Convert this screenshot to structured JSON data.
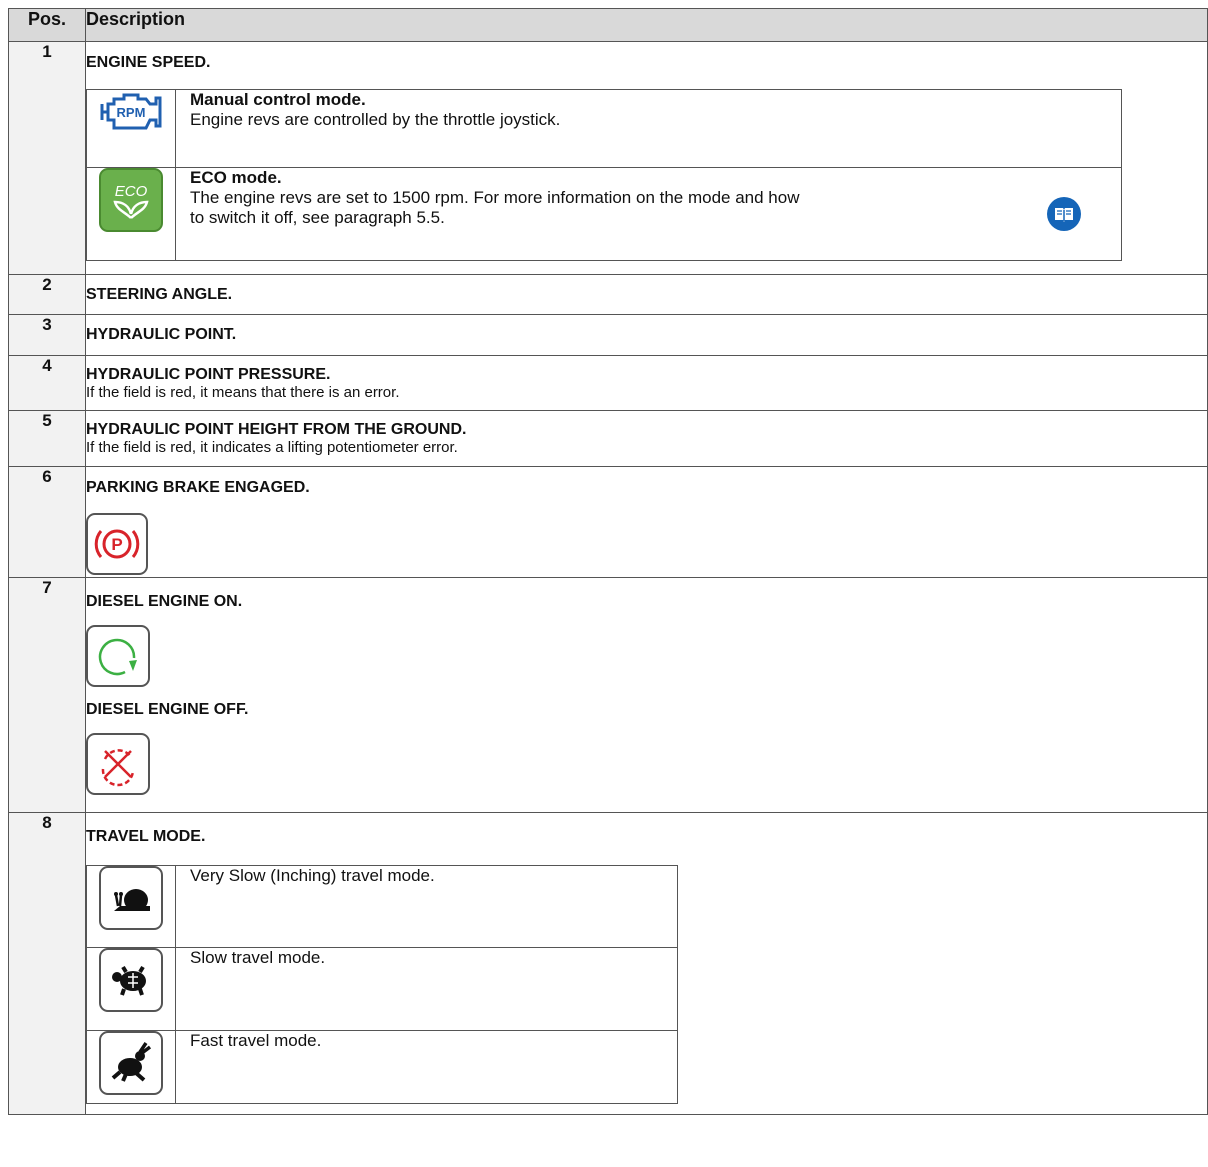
{
  "header": {
    "pos": "Pos.",
    "description": "Description"
  },
  "rows": [
    {
      "pos": "1",
      "title": "ENGINE SPEED.",
      "modes": [
        {
          "icon": "rpm-engine-icon",
          "icon_text": "RPM",
          "title": "Manual control mode.",
          "text": "Engine revs are controlled by the throttle joystick."
        },
        {
          "icon": "eco-mode-icon",
          "icon_text": "ECO",
          "title": "ECO mode.",
          "text_line1": "The engine revs are set to 1500 rpm. For more information on the mode and how",
          "text_line2": "to switch it off, see paragraph 5.5.",
          "ref_icon": "book-icon"
        }
      ]
    },
    {
      "pos": "2",
      "title": "STEERING ANGLE."
    },
    {
      "pos": "3",
      "title": "HYDRAULIC POINT."
    },
    {
      "pos": "4",
      "title": "HYDRAULIC POINT PRESSURE.",
      "text": "If the field is red, it means that there is an error."
    },
    {
      "pos": "5",
      "title": "HYDRAULIC POINT HEIGHT FROM THE GROUND.",
      "text": "If the field is red, it indicates a lifting potentiometer error."
    },
    {
      "pos": "6",
      "title": "PARKING BRAKE ENGAGED.",
      "icon": "parking-brake-icon",
      "icon_text": "P"
    },
    {
      "pos": "7",
      "title_on": "DIESEL ENGINE ON.",
      "icon_on": "engine-on-icon",
      "title_off": "DIESEL ENGINE OFF.",
      "icon_off": "engine-off-icon"
    },
    {
      "pos": "8",
      "title": "TRAVEL MODE.",
      "modes": [
        {
          "icon": "snail-icon",
          "text": "Very Slow (Inching) travel mode."
        },
        {
          "icon": "turtle-icon",
          "text": "Slow travel mode."
        },
        {
          "icon": "rabbit-icon",
          "text": "Fast travel mode."
        }
      ]
    }
  ],
  "colors": {
    "header_bg": "#d9d9d9",
    "pos_bg": "#f2f2f2",
    "rpm_blue": "#2060b0",
    "eco_green": "#6ab04c",
    "parking_red": "#d8232a",
    "engine_on_green": "#3cb043",
    "engine_off_red": "#d8232a",
    "book_blue": "#1565b8"
  }
}
